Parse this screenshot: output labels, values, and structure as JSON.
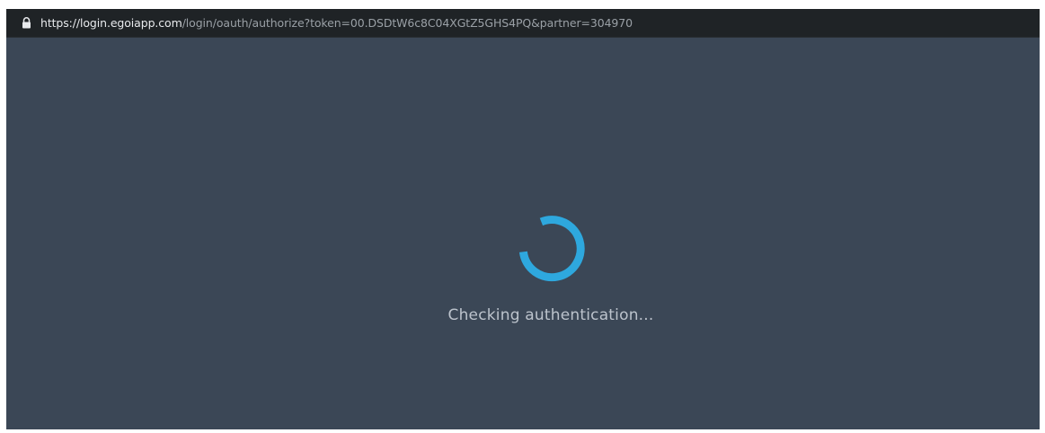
{
  "browser": {
    "url_host": "https://login.egoiapp.com",
    "url_path": "/login/oauth/authorize?token=00.DSDtW6c8C04XGtZ5GHS4PQ&partner=304970",
    "lock_icon": "lock-icon"
  },
  "page": {
    "status_text": "Checking authentication...",
    "spinner_icon": "loading-spinner-icon"
  },
  "colors": {
    "page_background": "#3b4756",
    "address_bar_background": "#1f2326",
    "spinner_accent": "#2ea8de",
    "status_text": "#bcc3cc"
  }
}
